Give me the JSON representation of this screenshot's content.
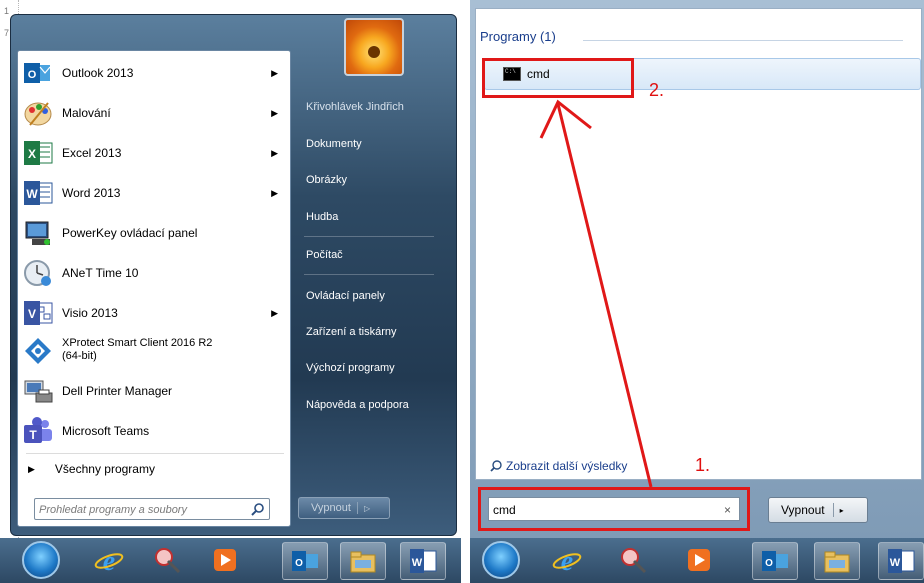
{
  "left_panel": {
    "ruler_mark": "7",
    "ruler_mark2": "1",
    "programs": [
      {
        "label": "Outlook 2013",
        "icon": "outlook-icon",
        "submenu": true
      },
      {
        "label": "Malování",
        "icon": "paint-icon",
        "submenu": true
      },
      {
        "label": "Excel 2013",
        "icon": "excel-icon",
        "submenu": true
      },
      {
        "label": "Word 2013",
        "icon": "word-icon",
        "submenu": true
      },
      {
        "label": "PowerKey ovládací panel",
        "icon": "powerkey-icon",
        "submenu": false
      },
      {
        "label": "ANeT Time 10",
        "icon": "anet-time-icon",
        "submenu": false
      },
      {
        "label": "Visio 2013",
        "icon": "visio-icon",
        "submenu": true
      },
      {
        "label": "XProtect Smart Client 2016 R2",
        "label2": "(64-bit)",
        "icon": "xprotect-icon",
        "submenu": false
      },
      {
        "label": "Dell Printer Manager",
        "icon": "printer-manager-icon",
        "submenu": false
      },
      {
        "label": "Microsoft Teams",
        "icon": "teams-icon",
        "submenu": false
      }
    ],
    "all_programs": "Všechny programy",
    "search_placeholder": "Prohledat programy a soubory",
    "right_links": [
      "Křivohlávek Jindřich",
      "Dokumenty",
      "Obrázky",
      "Hudba",
      "Počítač",
      "Ovládací panely",
      "Zařízení a tiskárny",
      "Výchozí programy",
      "Nápověda a podpora"
    ],
    "shutdown": "Vypnout",
    "shutdown_arrow": "▷"
  },
  "right_panel": {
    "results_header": "Programy (1)",
    "result_item": "cmd",
    "more_results": "Zobrazit další výsledky",
    "search_value": "cmd",
    "clear": "×",
    "shutdown": "Vypnout",
    "shutdown_arrow": "▸"
  },
  "annotations": {
    "step1": "1.",
    "step2": "2.",
    "color": "#e01818"
  },
  "taskbar_icons": [
    "start-orb-icon",
    "internet-explorer-icon",
    "snipping-tool-icon",
    "media-player-icon",
    "outlook-icon",
    "file-explorer-icon",
    "word-icon"
  ]
}
